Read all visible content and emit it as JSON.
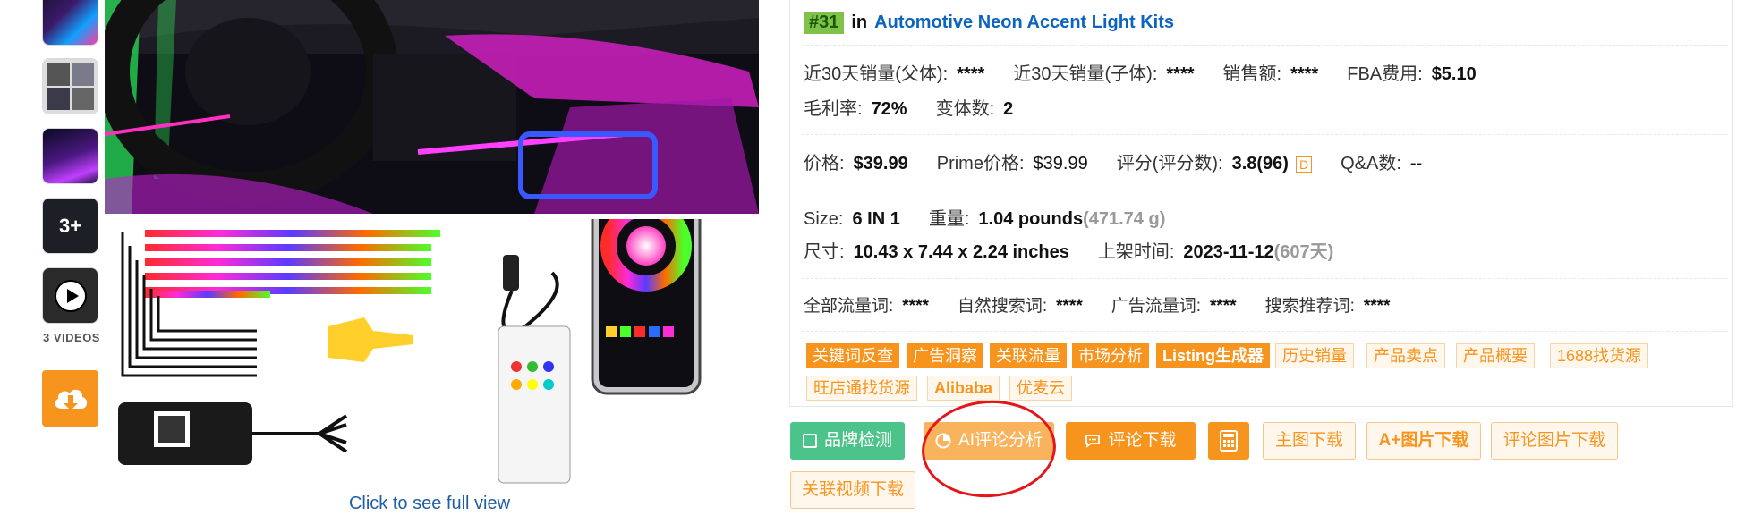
{
  "thumbnails": {
    "videos_label": "3 VIDEOS",
    "more_count": "3+"
  },
  "main_image": {
    "click_to_see": "Click to see full view"
  },
  "rank": {
    "badge": "#31",
    "in": "in",
    "category": "Automotive Neon Accent Light Kits"
  },
  "metrics": {
    "sales_parent_label": "近30天销量(父体):",
    "sales_parent_value": "****",
    "sales_child_label": "近30天销量(子体):",
    "sales_child_value": "****",
    "revenue_label": "销售额:",
    "revenue_value": "****",
    "fba_label": "FBA费用:",
    "fba_value": "$5.10",
    "margin_label": "毛利率:",
    "margin_value": "72%",
    "variants_label": "变体数:",
    "variants_value": "2",
    "price_label": "价格:",
    "price_value": "$39.99",
    "prime_label": "Prime价格:",
    "prime_value": "$39.99",
    "rating_label": "评分(评分数):",
    "rating_value": "3.8(96)",
    "rating_badge": "D",
    "qa_label": "Q&A数:",
    "qa_value": "--",
    "size_label": "Size:",
    "size_value": "6 IN 1",
    "weight_label": "重量:",
    "weight_value": "1.04 pounds",
    "weight_grams": "(471.74 g)",
    "dims_label": "尺寸:",
    "dims_value": "10.43 x 7.44 x 2.24 inches",
    "listed_label": "上架时间:",
    "listed_value": "2023-11-12",
    "listed_days": "(607天)",
    "all_kw_label": "全部流量词:",
    "all_kw_value": "****",
    "organic_kw_label": "自然搜索词:",
    "organic_kw_value": "****",
    "ad_kw_label": "广告流量词:",
    "ad_kw_value": "****",
    "search_rec_label": "搜索推荐词:",
    "search_rec_value": "****"
  },
  "tags_row1": [
    "关键词反查",
    "广告洞察",
    "关联流量",
    "市场分析",
    "Listing生成器",
    "历史销量",
    "产品卖点",
    "产品概要",
    "1688找货源"
  ],
  "tags_row2": [
    "旺店通找货源",
    "Alibaba",
    "优麦云"
  ],
  "actions": {
    "brand_check": "品牌检测",
    "ai_review": "AI评论分析",
    "review_download": "评论下载",
    "main_image_download": "主图下载",
    "aplus_download": "A+图片下载",
    "review_image_download": "评论图片下载",
    "related_video_download": "关联视频下载"
  },
  "colors": {
    "accent_orange": "#f7941d",
    "green": "#4cc38a",
    "link_blue": "#0b64c0",
    "highlight_red": "#e3161c"
  }
}
